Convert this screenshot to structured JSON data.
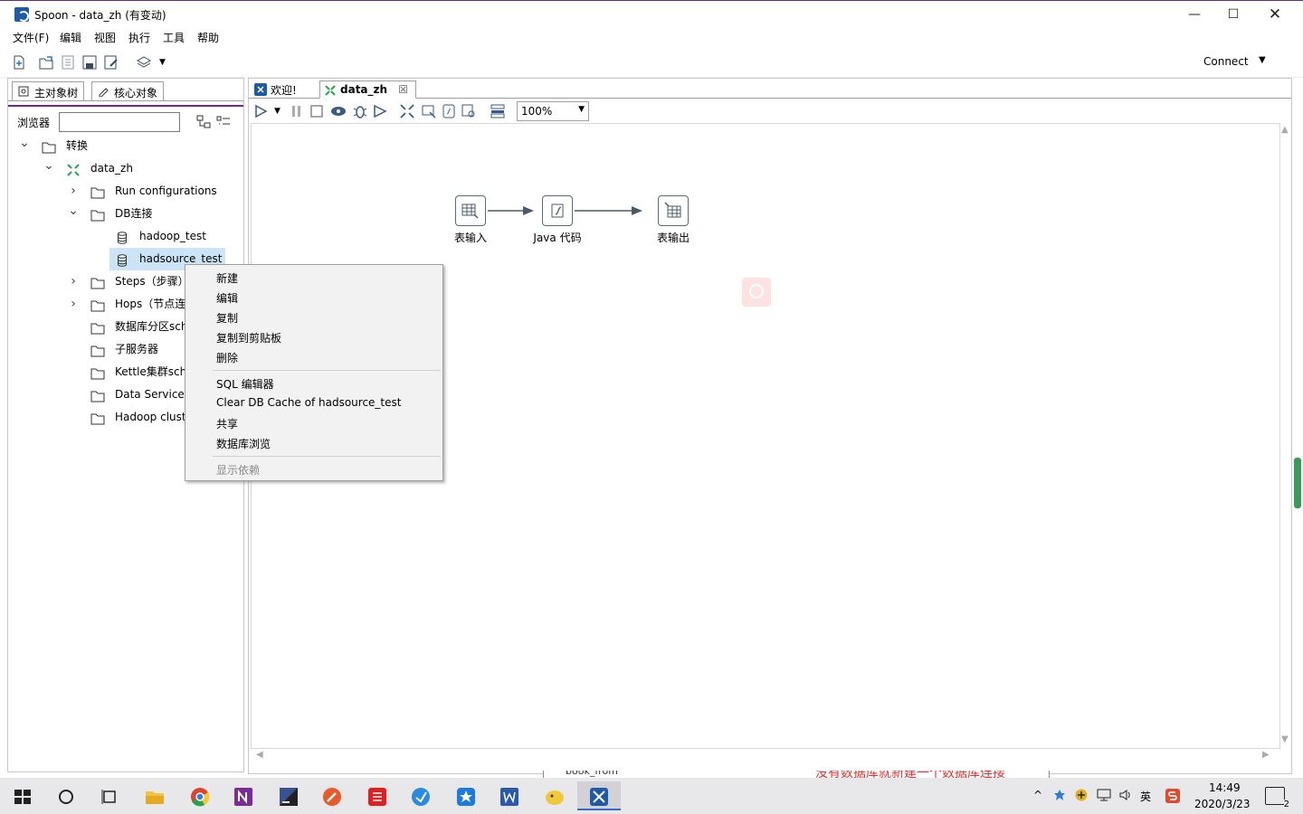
{
  "window": {
    "title": "Spoon - data_zh (有变动)",
    "controls": {
      "minimize": "—",
      "maximize": "☐",
      "close": "✕"
    }
  },
  "menubar": [
    "文件(F)",
    "编辑",
    "视图",
    "执行",
    "工具",
    "帮助"
  ],
  "toolbar": {
    "connect_label": "Connect"
  },
  "left_panel": {
    "tabs": [
      {
        "label": "主对象树"
      },
      {
        "label": "核心对象"
      }
    ],
    "browser_label": "浏览器",
    "search_value": "",
    "tree": [
      {
        "label": "转换",
        "chevron": "v",
        "icon": "folder-icon"
      },
      {
        "label": "data_zh",
        "chevron": "v",
        "icon": "transformation-icon"
      },
      {
        "label": "Run configurations",
        "chevron": ">",
        "icon": "folder-icon"
      },
      {
        "label": "DB连接",
        "chevron": "v",
        "icon": "folder-icon"
      },
      {
        "label": "hadoop_test",
        "chevron": "",
        "icon": "database-icon"
      },
      {
        "label": "hadsource_test",
        "chevron": "",
        "icon": "database-icon"
      },
      {
        "label": "Steps（步骤）",
        "chevron": ">",
        "icon": "folder-icon"
      },
      {
        "label": "Hops（节点连",
        "chevron": ">",
        "icon": "folder-icon"
      },
      {
        "label": "数据库分区sch",
        "chevron": "",
        "icon": "folder-icon"
      },
      {
        "label": "子服务器",
        "chevron": "",
        "icon": "folder-icon"
      },
      {
        "label": "Kettle集群sch",
        "chevron": "",
        "icon": "folder-icon"
      },
      {
        "label": "Data Services",
        "chevron": "",
        "icon": "folder-icon"
      },
      {
        "label": "Hadoop clust",
        "chevron": "",
        "icon": "folder-icon"
      }
    ]
  },
  "editor": {
    "tabs": [
      {
        "label": "欢迎!",
        "active": false
      },
      {
        "label": "data_zh",
        "active": true,
        "close": "☒"
      }
    ],
    "zoom": "100%",
    "steps": [
      {
        "label": "表输入",
        "icon": "table-input-icon"
      },
      {
        "label": "Java 代码",
        "icon": "java-code-icon"
      },
      {
        "label": "表输出",
        "icon": "table-output-icon"
      }
    ]
  },
  "context_menu": {
    "group1": [
      "新建",
      "编辑",
      "复制",
      "复制到剪贴板",
      "删除"
    ],
    "group2": [
      "SQL 编辑器",
      "Clear DB Cache of hadsource_test",
      "共享",
      "数据库浏览"
    ],
    "group3_disabled": [
      "显示依赖"
    ]
  },
  "behind_window": {
    "text_left": "book_from",
    "text_right": "没有数据库就新建一个数据库连接"
  },
  "taskbar": {
    "tray_text": [
      "^",
      "英"
    ],
    "time": "14:49",
    "date": "2020/3/23",
    "notification_count": "2"
  },
  "colors": {
    "accent_purple": "#6a2a8a",
    "selection": "#cce4f7",
    "kettle_green": "#2aa84a",
    "spoon_blue": "#1e5aa8"
  }
}
